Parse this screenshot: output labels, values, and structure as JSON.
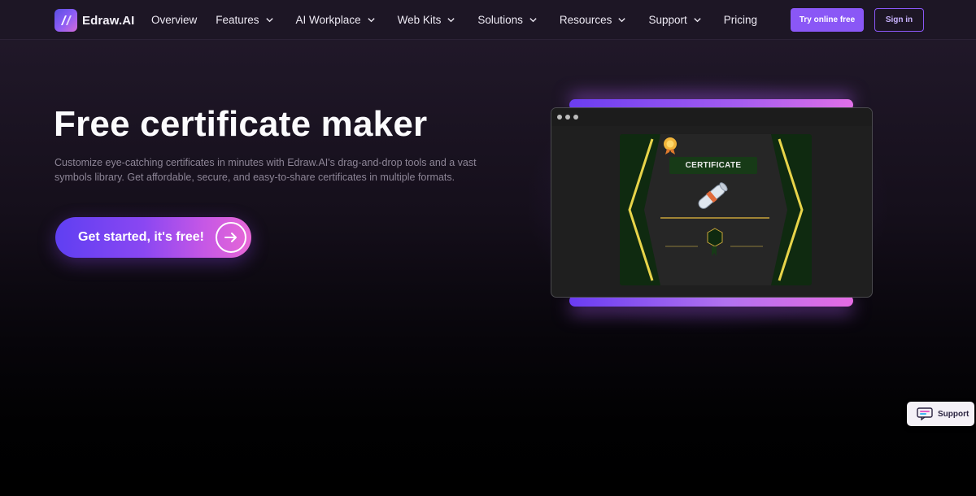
{
  "brand": {
    "name": "Edraw.AI"
  },
  "nav": {
    "items": [
      {
        "label": "Overview",
        "dropdown": false
      },
      {
        "label": "Features",
        "dropdown": true
      },
      {
        "label": "AI Workplace",
        "dropdown": true
      },
      {
        "label": "Web Kits",
        "dropdown": true
      },
      {
        "label": "Solutions",
        "dropdown": true
      },
      {
        "label": "Resources",
        "dropdown": true
      },
      {
        "label": "Support",
        "dropdown": true
      },
      {
        "label": "Pricing",
        "dropdown": false
      }
    ],
    "try_label": "Try online free",
    "signin_label": "Sign in"
  },
  "hero": {
    "title": "Free certificate maker",
    "description": "Customize eye-catching certificates in minutes with Edraw.AI's drag-and-drop tools and a vast symbols library. Get affordable, secure, and easy-to-share certificates in multiple formats.",
    "cta_label": "Get started, it's free!"
  },
  "preview": {
    "certificate_label": "CERTIFICATE"
  },
  "support_widget": {
    "label": "Support"
  },
  "colors": {
    "accent": "#8a57f6",
    "certificate_gold": "#e8d44a",
    "certificate_green": "#0f2a10"
  },
  "icons": {
    "logo": "edraw-logo-icon",
    "chevron": "chevron-down-icon",
    "cta_arrow": "arrow-right-icon",
    "support": "chat-bubble-icon"
  }
}
